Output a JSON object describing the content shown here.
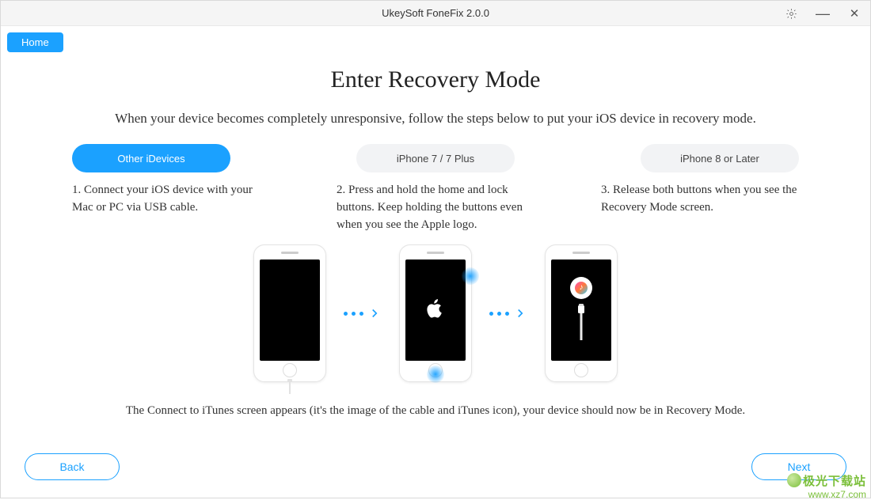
{
  "window": {
    "title": "UkeySoft FoneFix 2.0.0"
  },
  "nav": {
    "home": "Home"
  },
  "page": {
    "title": "Enter Recovery Mode",
    "subtitle": "When your device becomes completely unresponsive, follow the steps below to put your iOS device in recovery mode."
  },
  "tabs": [
    {
      "label": "Other iDevices",
      "active": true
    },
    {
      "label": "iPhone 7 / 7 Plus",
      "active": false
    },
    {
      "label": "iPhone 8 or Later",
      "active": false
    }
  ],
  "steps": [
    "1. Connect your iOS device with your Mac or PC via USB cable.",
    "2. Press and hold the home and lock buttons. Keep holding the buttons even when you see the Apple logo.",
    "3. Release both buttons when you see the Recovery Mode screen."
  ],
  "footnote": "The Connect to iTunes screen appears (it's the image of the cable and iTunes icon), your device should now be in Recovery Mode.",
  "buttons": {
    "back": "Back",
    "next": "Next"
  },
  "watermark": {
    "line1": "极光下载站",
    "line2": "www.xz7.com"
  }
}
